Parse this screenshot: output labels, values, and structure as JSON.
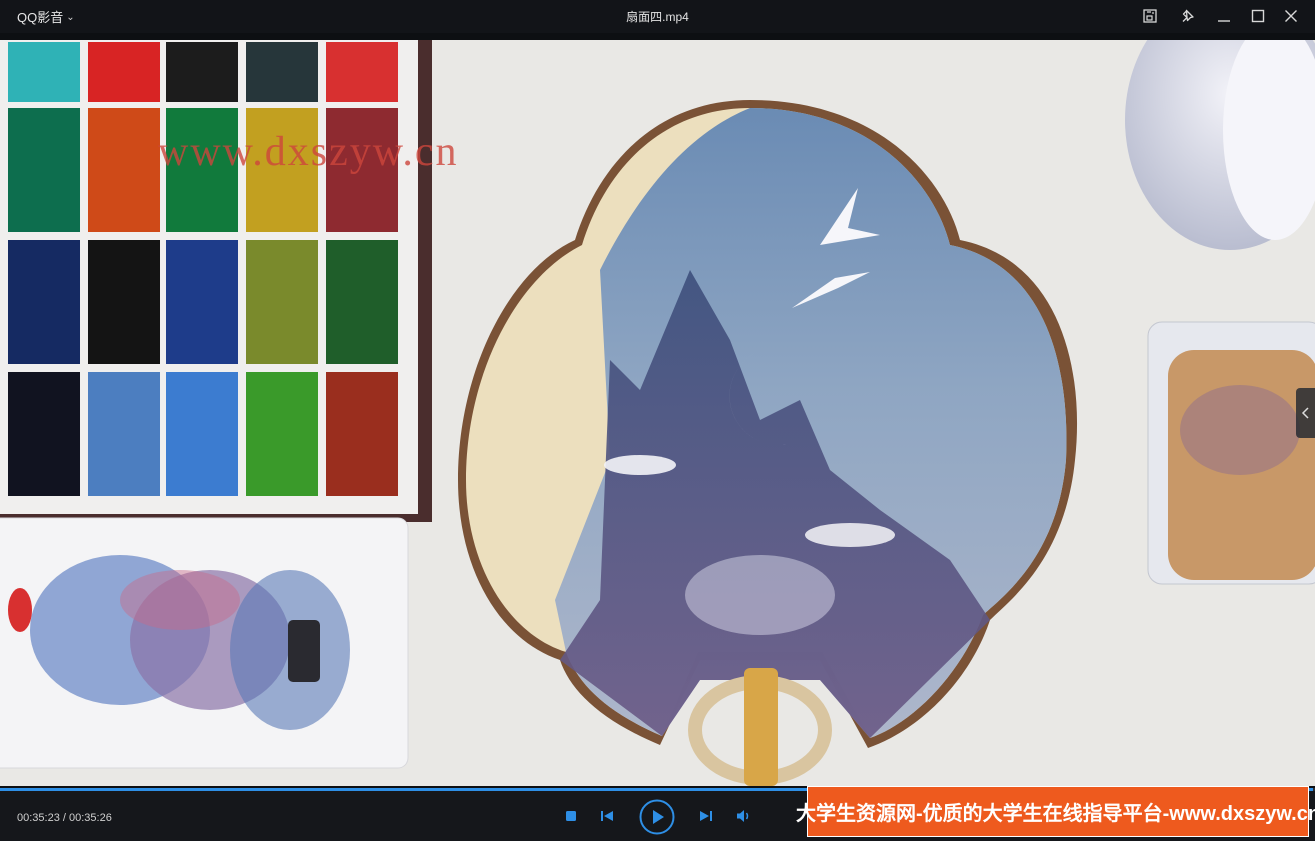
{
  "app": {
    "name": "QQ影音"
  },
  "window": {
    "title": "扇面四.mp4"
  },
  "player": {
    "current_time": "00:35:23",
    "duration": "00:35:26",
    "progress_fraction": 0.9986,
    "time_label": "00:35:23 / 00:35:26"
  },
  "video": {
    "watermark_text": "www.dxszyw.cn",
    "banner_text": "大学生资源网-优质的大学生在线指导平台-www.dxszyw.cn"
  },
  "colors": {
    "accent": "#2e8fe6",
    "banner_bg": "#ee5a1e",
    "watermark": "#cd463c"
  },
  "icons": {
    "title_bar": [
      "screenshot-icon",
      "pin-icon",
      "minimize-icon",
      "maximize-icon",
      "close-icon"
    ],
    "controls": [
      "stop-icon",
      "previous-icon",
      "play-icon",
      "next-icon",
      "volume-icon"
    ]
  }
}
